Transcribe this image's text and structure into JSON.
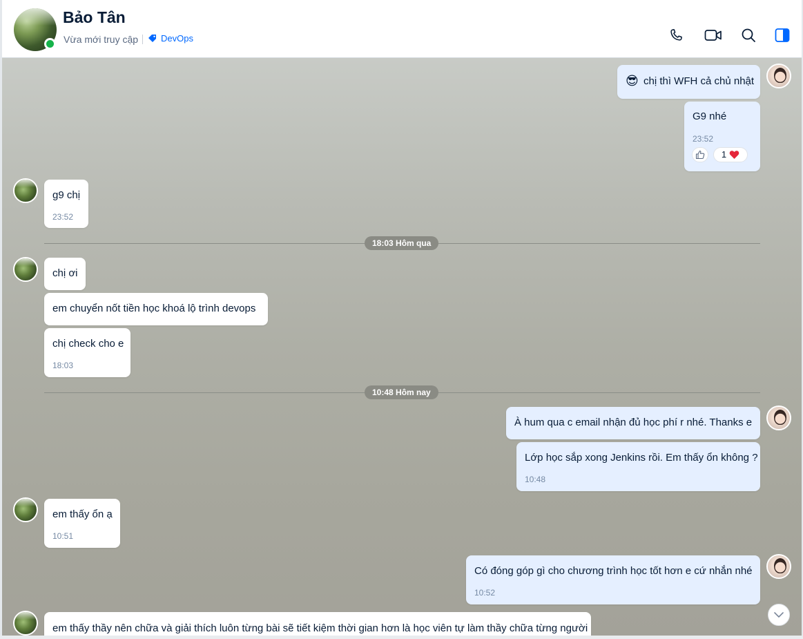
{
  "header": {
    "name": "Bảo Tân",
    "status": "Vừa mới truy cập",
    "tag": "DevOps",
    "icons": [
      "phone-icon",
      "video-call-icon",
      "search-icon",
      "sidebar-toggle-icon"
    ]
  },
  "colors": {
    "accent": "#0068ff",
    "online": "#16b34a",
    "outgoing_bubble": "#e5efff",
    "incoming_bubble": "#ffffff"
  },
  "messages": {
    "m1": {
      "text": "chị thì WFH cả chủ nhật",
      "emoji": "😎"
    },
    "m2": {
      "text": "G9 nhé",
      "time": "23:52",
      "reaction_count": "1"
    },
    "m3": {
      "text": "g9 chị",
      "time": "23:52"
    },
    "d1": {
      "label": "18:03 Hôm qua"
    },
    "m4": {
      "text": "chị ơi"
    },
    "m5": {
      "text": "em chuyển nốt tiền học khoá lộ trình devops"
    },
    "m6": {
      "text": "chị check cho e",
      "time": "18:03"
    },
    "d2": {
      "label": "10:48 Hôm nay"
    },
    "m7": {
      "text": "À hum qua c email nhận đủ học phí r nhé. Thanks e"
    },
    "m8": {
      "text": "Lớp học sắp xong Jenkins rồi. Em thấy ổn không ?",
      "time": "10:48"
    },
    "m9": {
      "text": "em thấy ổn ạ",
      "time": "10:51"
    },
    "m10": {
      "text": "Có đóng góp gì cho chương trình học tốt hơn e cứ nhắn nhé",
      "time": "10:52"
    },
    "m11": {
      "text": "em thấy thầy nên chữa và giải thích luôn từng bài sẽ tiết kiệm thời gian hơn là học viên tự làm thầy chữa từng người"
    }
  }
}
